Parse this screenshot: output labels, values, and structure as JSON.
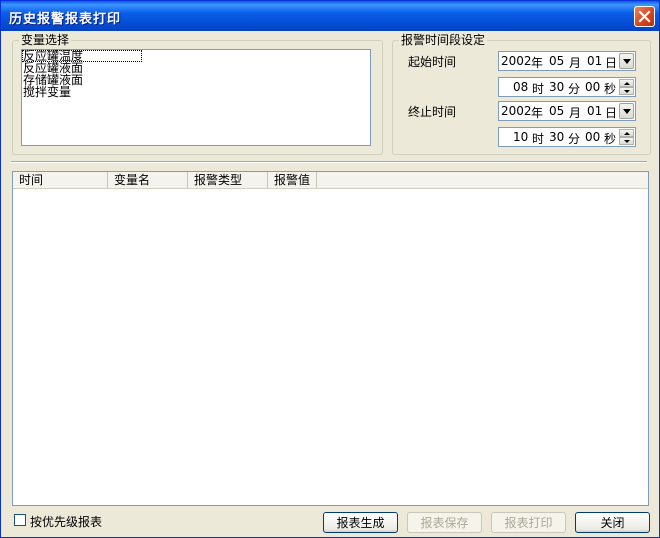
{
  "window": {
    "title": "历史报警报表打印"
  },
  "variable_group": {
    "legend": "变量选择",
    "items": [
      "反应罐温度",
      "反应罐液面",
      "存储罐液面",
      "搅拌变量"
    ]
  },
  "time_group": {
    "legend": "报警时间段设定",
    "start": {
      "label": "起始时间",
      "year": "2002",
      "year_unit": "年",
      "month": "05",
      "month_unit": "月",
      "day": "01",
      "day_unit": "日",
      "hour": "08",
      "hour_unit": "时",
      "minute": "30",
      "minute_unit": "分",
      "second": "00",
      "second_unit": "秒"
    },
    "end": {
      "label": "终止时间",
      "year": "2002",
      "year_unit": "年",
      "month": "05",
      "month_unit": "月",
      "day": "01",
      "day_unit": "日",
      "hour": "10",
      "hour_unit": "时",
      "minute": "30",
      "minute_unit": "分",
      "second": "00",
      "second_unit": "秒"
    }
  },
  "table": {
    "columns": [
      "时间",
      "变量名",
      "报警类型",
      "报警值"
    ]
  },
  "footer": {
    "priority_checkbox": {
      "label": "按优先级报表",
      "checked": false
    },
    "buttons": {
      "generate": "报表生成",
      "save": "报表保存",
      "print": "报表打印",
      "close": "关闭"
    }
  },
  "colors": {
    "titlebar": "#0a5ee8",
    "dialog_bg": "#ece9d8",
    "close_button": "#d3421e"
  },
  "icons": {
    "close": "close-icon",
    "dropdown": "chevron-down-icon",
    "spin_up": "chevron-up-icon",
    "spin_down": "chevron-down-icon"
  }
}
